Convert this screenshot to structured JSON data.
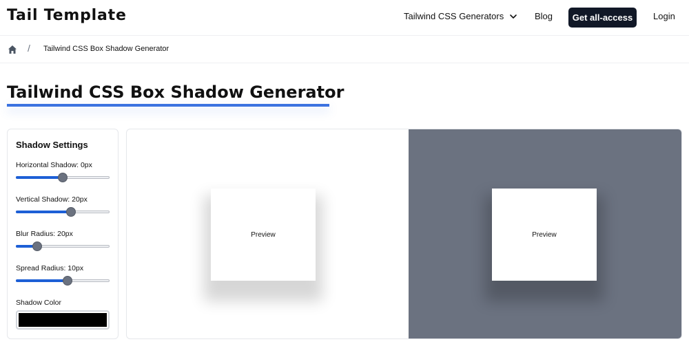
{
  "header": {
    "logo": "Tail Template",
    "nav_generators": "Tailwind CSS Generators",
    "nav_blog": "Blog",
    "cta": "Get all-access",
    "login": "Login"
  },
  "breadcrumb": {
    "separator": "/",
    "current": "Tailwind CSS Box Shadow Generator"
  },
  "page": {
    "title": "Tailwind CSS Box Shadow Generator"
  },
  "settings": {
    "title": "Shadow Settings",
    "sliders": [
      {
        "label": "Horizontal Shadow: 0px",
        "fraction": 0.5
      },
      {
        "label": "Vertical Shadow: 20px",
        "fraction": 0.59
      },
      {
        "label": "Blur Radius: 20px",
        "fraction": 0.23
      },
      {
        "label": "Spread Radius: 10px",
        "fraction": 0.55
      }
    ],
    "color_label": "Shadow Color",
    "color_value": "#000000"
  },
  "preview": {
    "light_label": "Preview",
    "dark_label": "Preview",
    "dark_bg": "#6b7280"
  },
  "colors": {
    "accent": "#1d5fd6",
    "underline": "#3b72e0",
    "cta_bg": "#111827"
  }
}
